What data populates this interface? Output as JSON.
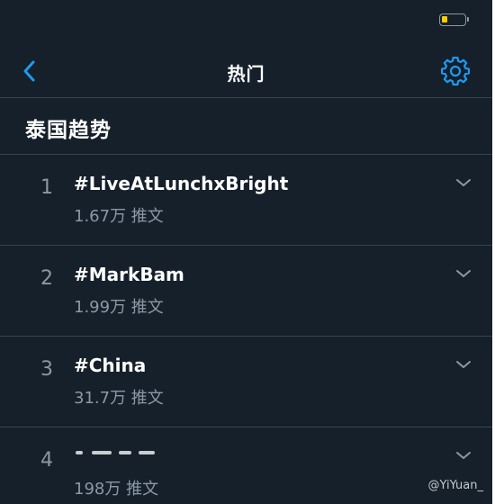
{
  "status_bar": {
    "battery_level": 0.25,
    "battery_color": "#ffcc00"
  },
  "nav": {
    "title": "热门",
    "back_icon": "chevron-left-icon",
    "settings_icon": "gear-icon",
    "accent_color": "#1d9bf0"
  },
  "section": {
    "title": "泰国趋势"
  },
  "trends": [
    {
      "rank": "1",
      "name": "#LiveAtLunchxBright",
      "count": "1.67万 推文"
    },
    {
      "rank": "2",
      "name": "#MarkBam",
      "count": "1.99万 推文"
    },
    {
      "rank": "3",
      "name": "#China",
      "count": "31.7万 推文"
    },
    {
      "rank": "4",
      "name": "",
      "count": "198万 推文"
    }
  ],
  "watermark": "@YiYuan_",
  "colors": {
    "background": "#15202b",
    "divider": "#38444d",
    "secondary_text": "#8b98a5",
    "primary_text": "#ffffff"
  }
}
